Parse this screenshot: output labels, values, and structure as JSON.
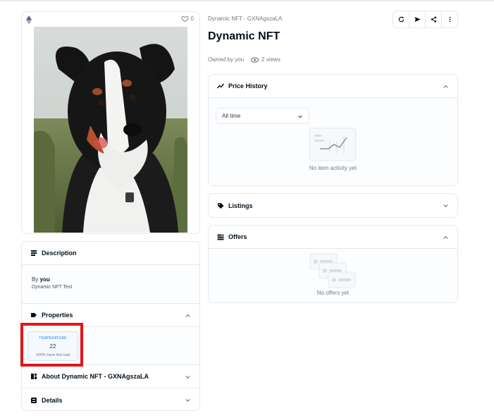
{
  "item": {
    "collection": "Dynamic NFT - GXNAgszaLA",
    "title": "Dynamic NFT",
    "owned_by": "Owned by you",
    "views": "2 views",
    "favorites": "0"
  },
  "description": {
    "header": "Description",
    "by_prefix": "By",
    "by_name": "you",
    "text": "Dynamic NFT Test"
  },
  "properties": {
    "header": "Properties",
    "traits": [
      {
        "type": "TEMPERATURE",
        "value": "22",
        "rarity": "100% have this trait"
      }
    ]
  },
  "about": {
    "header": "About Dynamic NFT - GXNAgszaLA"
  },
  "details": {
    "header": "Details"
  },
  "price_history": {
    "header": "Price History",
    "range_selected": "All time",
    "empty": "No item activity yet"
  },
  "listings": {
    "header": "Listings"
  },
  "offers": {
    "header": "Offers",
    "empty": "No offers yet"
  },
  "icons": {
    "actions": [
      "refresh-icon",
      "send-icon",
      "share-icon",
      "more-icon"
    ]
  },
  "colors": {
    "highlight": "#e3141b",
    "accent": "#2081e2"
  }
}
